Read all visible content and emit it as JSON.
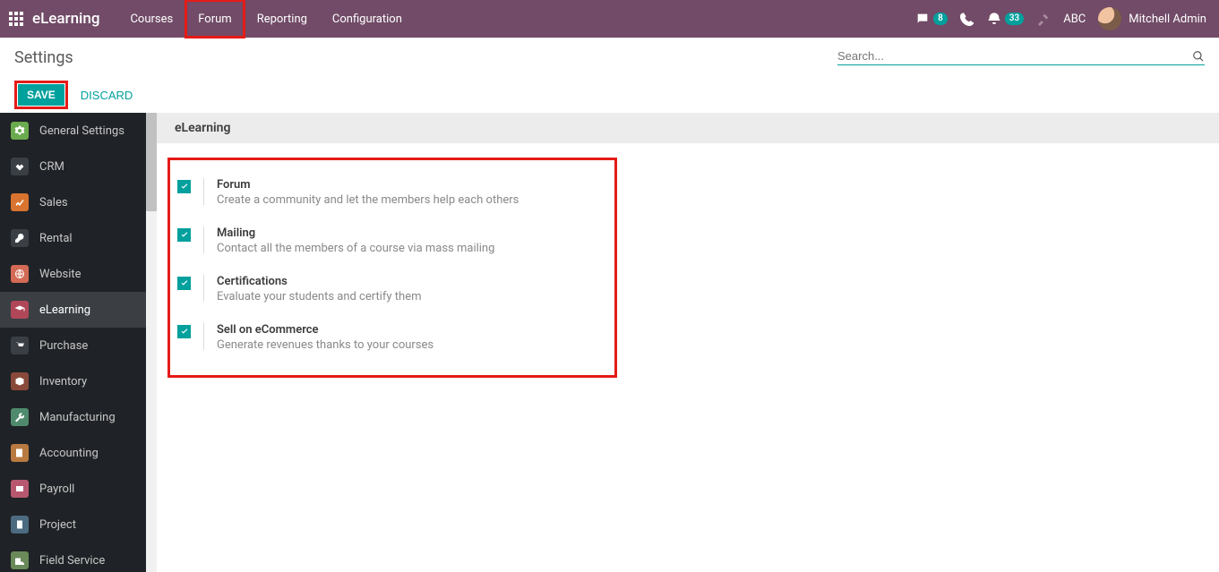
{
  "header": {
    "app_title": "eLearning",
    "menu": [
      "Courses",
      "Forum",
      "Reporting",
      "Configuration"
    ],
    "highlighted_menu_index": 1,
    "badges": {
      "messages": "8",
      "activities": "33"
    },
    "company": "ABC",
    "user_name": "Mitchell Admin"
  },
  "controlbar": {
    "page_title": "Settings",
    "search_placeholder": "Search..."
  },
  "actions": {
    "save_label": "SAVE",
    "discard_label": "DISCARD"
  },
  "sidebar": {
    "items": [
      {
        "label": "General Settings"
      },
      {
        "label": "CRM"
      },
      {
        "label": "Sales"
      },
      {
        "label": "Rental"
      },
      {
        "label": "Website"
      },
      {
        "label": "eLearning"
      },
      {
        "label": "Purchase"
      },
      {
        "label": "Inventory"
      },
      {
        "label": "Manufacturing"
      },
      {
        "label": "Accounting"
      },
      {
        "label": "Payroll"
      },
      {
        "label": "Project"
      },
      {
        "label": "Field Service"
      }
    ],
    "active_index": 5
  },
  "section": {
    "title": "eLearning"
  },
  "options": [
    {
      "checked": true,
      "title": "Forum",
      "desc": "Create a community and let the members help each others"
    },
    {
      "checked": true,
      "title": "Mailing",
      "desc": "Contact all the members of a course via mass mailing"
    },
    {
      "checked": true,
      "title": "Certifications",
      "desc": "Evaluate your students and certify them"
    },
    {
      "checked": true,
      "title": "Sell on eCommerce",
      "desc": "Generate revenues thanks to your courses"
    }
  ],
  "colors": {
    "brand": "#714b67",
    "accent": "#00a09d"
  }
}
